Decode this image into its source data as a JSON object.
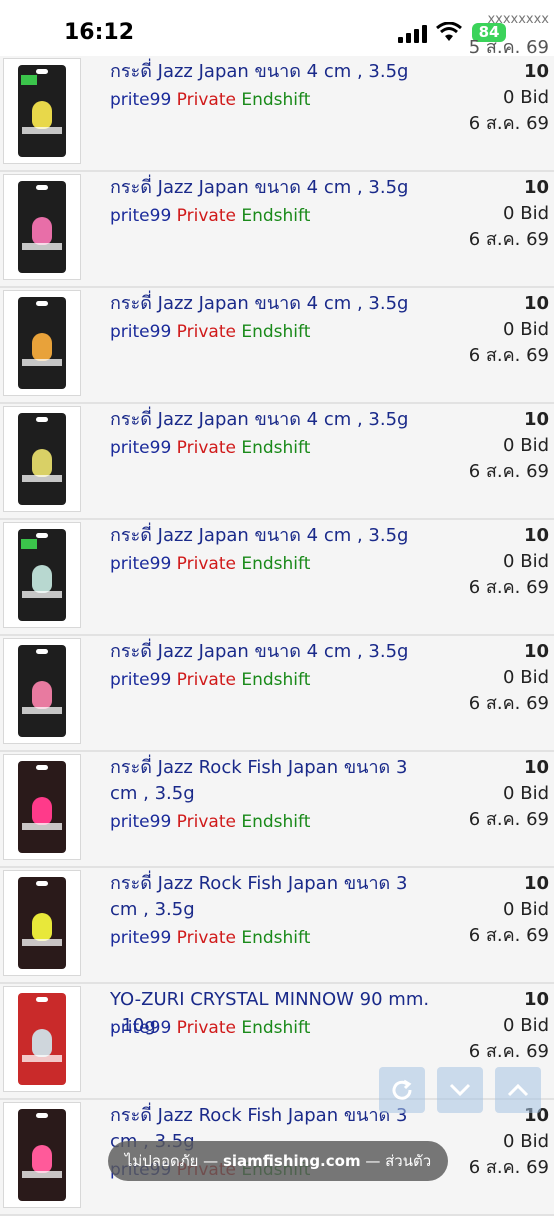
{
  "status_bar": {
    "time": "16:12",
    "battery": "84"
  },
  "top_peek": {
    "masked_text": "xxxxxxxx",
    "date": "5 ส.ค. 69"
  },
  "listings": [
    {
      "title": "กระดี่ Jazz Japan ขนาด 4 cm , 3.5g",
      "seller": "prite99",
      "private": "Private",
      "endshift": "Endshift",
      "qty": "10",
      "bids": "0 Bid",
      "date": "6 ส.ค. 69",
      "pkg_color": "#1e1e1e",
      "lure_color": "#e8d84a",
      "tag": true
    },
    {
      "title": "กระดี่ Jazz Japan ขนาด 4 cm , 3.5g",
      "seller": "prite99",
      "private": "Private",
      "endshift": "Endshift",
      "qty": "10",
      "bids": "0 Bid",
      "date": "6 ส.ค. 69",
      "pkg_color": "#1e1e1e",
      "lure_color": "#e86ea8",
      "tag": false
    },
    {
      "title": "กระดี่ Jazz Japan ขนาด 4 cm , 3.5g",
      "seller": "prite99",
      "private": "Private",
      "endshift": "Endshift",
      "qty": "10",
      "bids": "0 Bid",
      "date": "6 ส.ค. 69",
      "pkg_color": "#1e1e1e",
      "lure_color": "#e8a23a",
      "tag": false
    },
    {
      "title": "กระดี่ Jazz Japan ขนาด 4 cm , 3.5g",
      "seller": "prite99",
      "private": "Private",
      "endshift": "Endshift",
      "qty": "10",
      "bids": "0 Bid",
      "date": "6 ส.ค. 69",
      "pkg_color": "#1e1e1e",
      "lure_color": "#d9d066",
      "tag": false
    },
    {
      "title": "กระดี่ Jazz Japan ขนาด 4 cm , 3.5g",
      "seller": "prite99",
      "private": "Private",
      "endshift": "Endshift",
      "qty": "10",
      "bids": "0 Bid",
      "date": "6 ส.ค. 69",
      "pkg_color": "#1e1e1e",
      "lure_color": "#b8d8d0",
      "tag": true
    },
    {
      "title": "กระดี่ Jazz Japan ขนาด 4 cm , 3.5g",
      "seller": "prite99",
      "private": "Private",
      "endshift": "Endshift",
      "qty": "10",
      "bids": "0 Bid",
      "date": "6 ส.ค. 69",
      "pkg_color": "#1e1e1e",
      "lure_color": "#e87aa0",
      "tag": false
    },
    {
      "title": "กระดี่ Jazz Rock Fish Japan ขนาด 3 cm , 3.5g",
      "seller": "prite99",
      "private": "Private",
      "endshift": "Endshift",
      "qty": "10",
      "bids": "0 Bid",
      "date": "6 ส.ค. 69",
      "pkg_color": "#2a1a1a",
      "lure_color": "#ff3a8a",
      "tag": false
    },
    {
      "title": "กระดี่ Jazz Rock Fish Japan ขนาด 3 cm , 3.5g",
      "seller": "prite99",
      "private": "Private",
      "endshift": "Endshift",
      "qty": "10",
      "bids": "0 Bid",
      "date": "6 ส.ค. 69",
      "pkg_color": "#2a1a1a",
      "lure_color": "#e8e83a",
      "tag": false
    },
    {
      "title": "YO-ZURI CRYSTAL MINNOW 90 mm. , 10g",
      "seller": "prite99",
      "private": "Private",
      "endshift": "Endshift",
      "qty": "10",
      "bids": "0 Bid",
      "date": "6 ส.ค. 69",
      "pkg_color": "#c92a2a",
      "lure_color": "#cfd6dc",
      "tag": false
    },
    {
      "title": "กระดี่ Jazz Rock Fish Japan ขนาด 3 cm , 3.5g",
      "seller": "prite99",
      "private": "Private",
      "endshift": "Endshift",
      "qty": "10",
      "bids": "0 Bid",
      "date": "6 ส.ค. 69",
      "pkg_color": "#2a1a1a",
      "lure_color": "#ff5a9a",
      "tag": false
    }
  ],
  "floating": {
    "refresh": "refresh-icon",
    "down": "chevron-down-icon",
    "up": "chevron-up-icon"
  },
  "url_bar": {
    "prefix": "ไม่ปลอดภัย — ",
    "domain": "siamfishing.com",
    "suffix": " — ส่วนตัว"
  }
}
